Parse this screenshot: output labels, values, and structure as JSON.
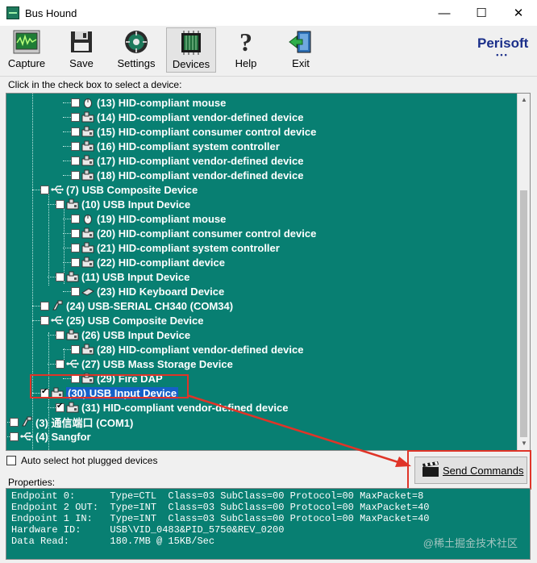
{
  "window": {
    "title": "Bus Hound",
    "minimize": "—",
    "maximize": "☐",
    "close": "✕"
  },
  "toolbar": {
    "items": [
      {
        "label": "Capture",
        "icon": "capture-icon"
      },
      {
        "label": "Save",
        "icon": "save-icon"
      },
      {
        "label": "Settings",
        "icon": "settings-icon"
      },
      {
        "label": "Devices",
        "icon": "devices-icon"
      },
      {
        "label": "Help",
        "icon": "help-icon"
      },
      {
        "label": "Exit",
        "icon": "exit-icon"
      }
    ],
    "logo": "Perisoft",
    "logo_dots": "•••"
  },
  "hint": "Click in the check box to select a device:",
  "tree": [
    {
      "label": "(13) HID-compliant mouse",
      "icon": "mouse-icon",
      "checked": false
    },
    {
      "label": "(14) HID-compliant vendor-defined device",
      "icon": "hid-device-icon",
      "checked": false
    },
    {
      "label": "(15) HID-compliant consumer control device",
      "icon": "hid-device-icon",
      "checked": false
    },
    {
      "label": "(16) HID-compliant system controller",
      "icon": "hid-device-icon",
      "checked": false
    },
    {
      "label": "(17) HID-compliant vendor-defined device",
      "icon": "hid-device-icon",
      "checked": false
    },
    {
      "label": "(18) HID-compliant vendor-defined device",
      "icon": "hid-device-icon",
      "checked": false
    },
    {
      "label": "(7) USB Composite Device",
      "icon": "usb-icon",
      "checked": false
    },
    {
      "label": "(10) USB Input Device",
      "icon": "hid-device-icon",
      "checked": false
    },
    {
      "label": "(19) HID-compliant mouse",
      "icon": "mouse-icon",
      "checked": false
    },
    {
      "label": "(20) HID-compliant consumer control device",
      "icon": "hid-device-icon",
      "checked": false
    },
    {
      "label": "(21) HID-compliant system controller",
      "icon": "hid-device-icon",
      "checked": false
    },
    {
      "label": "(22) HID-compliant device",
      "icon": "hid-device-icon",
      "checked": false
    },
    {
      "label": "(11) USB Input Device",
      "icon": "hid-device-icon",
      "checked": false
    },
    {
      "label": "(23) HID Keyboard Device",
      "icon": "keyboard-icon",
      "checked": false
    },
    {
      "label": "(24) USB-SERIAL CH340 (COM34)",
      "icon": "serial-port-icon",
      "checked": false
    },
    {
      "label": "(25) USB Composite Device",
      "icon": "usb-icon",
      "checked": false
    },
    {
      "label": "(26) USB Input Device",
      "icon": "hid-device-icon",
      "checked": false
    },
    {
      "label": "(28) HID-compliant vendor-defined device",
      "icon": "hid-device-icon",
      "checked": false
    },
    {
      "label": "(27) USB Mass Storage Device",
      "icon": "usb-icon",
      "checked": false
    },
    {
      "label": "(29) Fire DAP",
      "icon": "hid-device-icon",
      "checked": false
    },
    {
      "label": "(30) USB Input Device",
      "icon": "hid-device-icon",
      "checked": true,
      "selected": true
    },
    {
      "label": "(31) HID-compliant vendor-defined device",
      "icon": "hid-device-icon",
      "checked": true
    },
    {
      "label": "(3) 通信端口 (COM1)",
      "icon": "serial-port-icon",
      "checked": false
    },
    {
      "label": "(4) Sangfor",
      "icon": "usb-icon",
      "checked": false
    }
  ],
  "auto_select": {
    "label": "Auto select hot plugged devices",
    "checked": false
  },
  "send_button": {
    "label": "Send Commands",
    "icon": "clapperboard-icon"
  },
  "properties": {
    "label": "Properties:",
    "lines": [
      "Endpoint 0:      Type=CTL  Class=03 SubClass=00 Protocol=00 MaxPacket=8",
      "Endpoint 2 OUT:  Type=INT  Class=03 SubClass=00 Protocol=00 MaxPacket=40",
      "Endpoint 1 IN:   Type=INT  Class=03 SubClass=00 Protocol=00 MaxPacket=40",
      "Hardware ID:     USB\\VID_0483&PID_5750&REV_0200",
      "Data Read:       180.7MB @ 15KB/Sec"
    ]
  },
  "watermark": "@稀土掘金技术社区",
  "colors": {
    "tree_bg": "#087f72",
    "highlight": "#e03428",
    "selection": "#1560c9"
  }
}
